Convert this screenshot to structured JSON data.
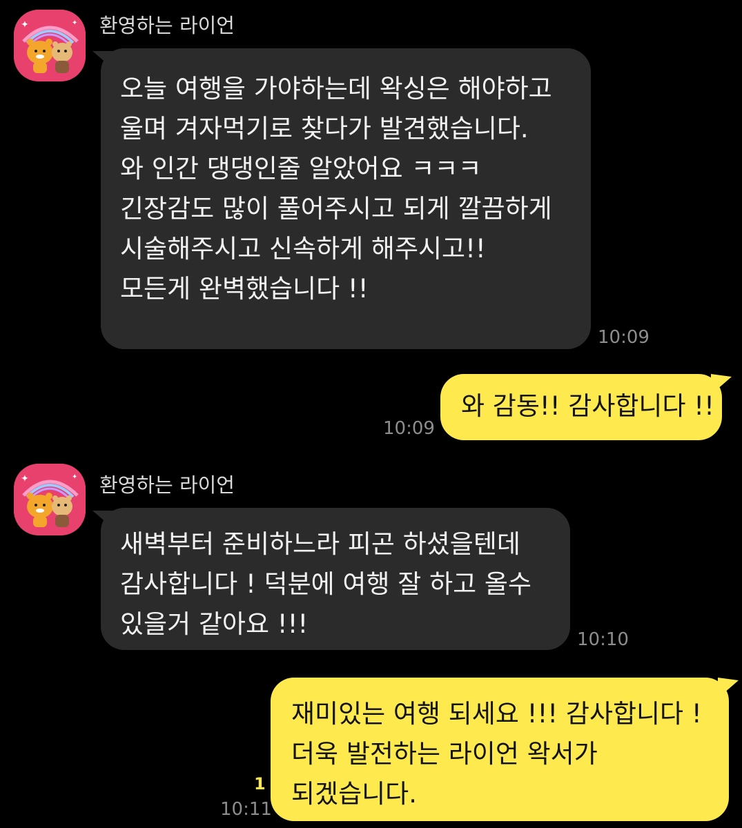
{
  "messages": [
    {
      "sender": "환영하는 라이언",
      "lines": [
        "오늘 여행을 가야하는데 왁싱은 해야하고",
        "울며 겨자먹기로 찾다가 발견했습니다.",
        "와 인간 댕댕인줄 알았어요 ㅋㅋㅋ",
        "긴장감도 많이 풀어주시고 되게 깔끔하게",
        "시술해주시고 신속하게 해주시고!!",
        "모든게 완벽했습니다 !!"
      ],
      "time": "10:09"
    },
    {
      "lines": [
        "와 감동!! 감사합니다 !!"
      ],
      "time": "10:09"
    },
    {
      "sender": "환영하는 라이언",
      "lines": [
        "새벽부터 준비하느라 피곤 하셨을텐데",
        "감사합니다 ! 덕분에 여행 잘 하고 올수",
        "있을거 같아요 !!!"
      ],
      "time": "10:10"
    },
    {
      "lines": [
        "재미있는 여행 되세요 !!! 감사합니다 !",
        "더욱 발전하는 라이언 왁서가",
        "되겠습니다."
      ],
      "time": "10:11",
      "unread": "1"
    }
  ],
  "avatar_icon": "ryan-and-friend-rainbow-avatar-icon",
  "colors": {
    "background": "#000000",
    "incoming_bubble": "#2b2b2b",
    "outgoing_bubble": "#fee94e",
    "avatar_bg": "#e8416e",
    "timestamp": "#8d8d8d",
    "unread": "#fee94e"
  }
}
